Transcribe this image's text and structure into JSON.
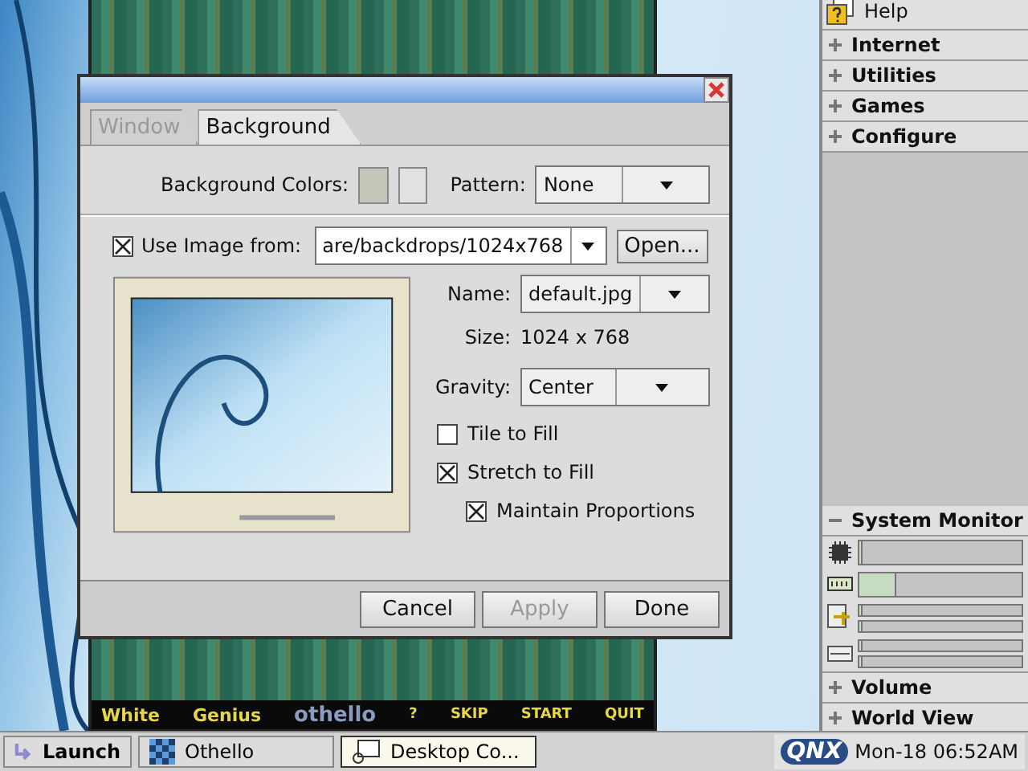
{
  "othello_window": {
    "footer": [
      {
        "label": "White",
        "kind": "text"
      },
      {
        "label": "Genius",
        "kind": "text"
      },
      {
        "label": "othello",
        "kind": "logo"
      },
      {
        "label": "?",
        "kind": "button"
      },
      {
        "label": "SKIP",
        "kind": "button"
      },
      {
        "label": "START",
        "kind": "button"
      },
      {
        "label": "QUIT",
        "kind": "button"
      }
    ]
  },
  "dialog": {
    "tabs": [
      {
        "label": "Window",
        "selected": false
      },
      {
        "label": "Background",
        "selected": true
      }
    ],
    "background_colors": {
      "label": "Background Colors:",
      "swatches": [
        {
          "color": "#c4c4b8"
        },
        {
          "color": "#e2e2e2"
        }
      ]
    },
    "pattern": {
      "label": "Pattern:",
      "value": "None"
    },
    "use_image": {
      "label": "Use Image from:",
      "checked": true,
      "path": "are/backdrops/1024x768",
      "open_button": "Open..."
    },
    "name": {
      "label": "Name:",
      "value": "default.jpg"
    },
    "size": {
      "label": "Size:",
      "value": "1024 x 768"
    },
    "gravity": {
      "label": "Gravity:",
      "value": "Center"
    },
    "options": [
      {
        "label": "Tile to Fill",
        "checked": false
      },
      {
        "label": "Stretch to Fill",
        "checked": true,
        "children": [
          {
            "label": "Maintain Proportions",
            "checked": true
          }
        ]
      }
    ],
    "buttons": [
      {
        "label": "Cancel",
        "disabled": false
      },
      {
        "label": "Apply",
        "disabled": true
      },
      {
        "label": "Done",
        "disabled": false
      }
    ]
  },
  "shelf": {
    "help": "Help",
    "groups_top": [
      {
        "label": "Internet",
        "expanded": false
      },
      {
        "label": "Utilities",
        "expanded": false
      },
      {
        "label": "Games",
        "expanded": false
      },
      {
        "label": "Configure",
        "expanded": false
      }
    ],
    "system_monitor": {
      "label": "System Monitor",
      "expanded": true,
      "meters": [
        {
          "kind": "cpu",
          "bars": [
            {
              "level": 0
            }
          ]
        },
        {
          "kind": "memory",
          "bars": [
            {
              "level": 0.22
            }
          ]
        },
        {
          "kind": "disk",
          "bars": [
            {
              "level": 0
            },
            {
              "level": 0
            }
          ]
        },
        {
          "kind": "network",
          "bars": [
            {
              "level": 0
            },
            {
              "level": 0
            }
          ]
        }
      ]
    },
    "groups_bottom": [
      {
        "label": "Volume",
        "expanded": false
      },
      {
        "label": "World View",
        "expanded": false
      }
    ]
  },
  "taskbar": {
    "launch": "Launch",
    "tasks": [
      {
        "label": "Othello",
        "kind": "game",
        "selected": false
      },
      {
        "label": "Desktop Co...",
        "kind": "desktop",
        "selected": true
      }
    ],
    "logo": "QNX",
    "clock": "Mon-18 06:52AM"
  }
}
